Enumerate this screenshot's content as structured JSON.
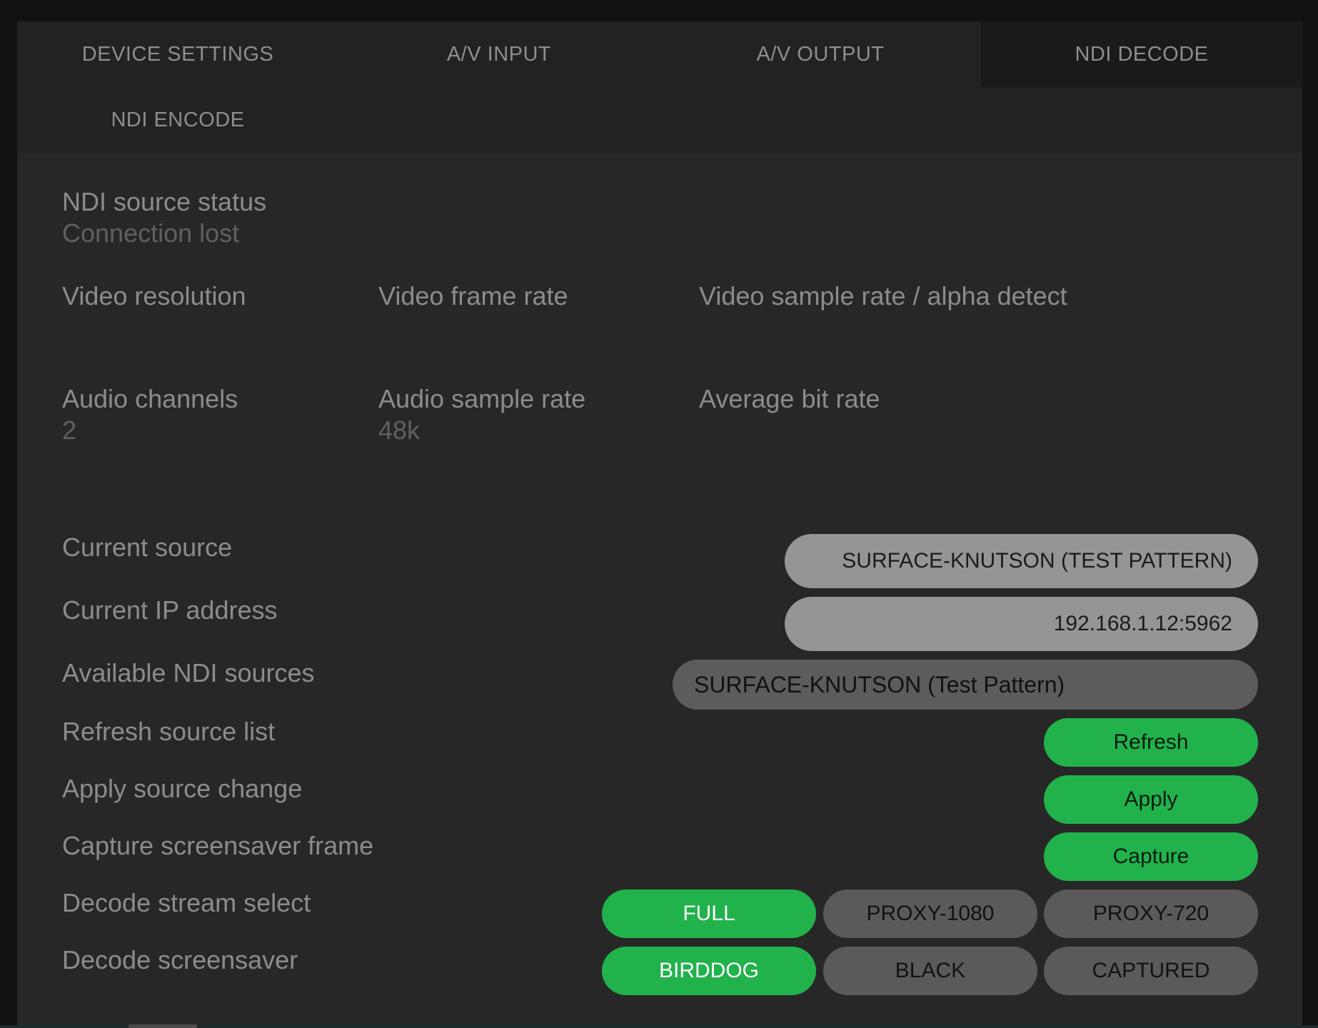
{
  "tabs": [
    {
      "label": "DEVICE SETTINGS",
      "active": false
    },
    {
      "label": "A/V INPUT",
      "active": false
    },
    {
      "label": "A/V OUTPUT",
      "active": false
    },
    {
      "label": "NDI DECODE",
      "active": true
    },
    {
      "label": "NDI ENCODE",
      "active": false
    }
  ],
  "status": {
    "source_status_label": "NDI source status",
    "source_status_value": "Connection lost",
    "video_resolution_label": "Video resolution",
    "video_resolution_value": "",
    "video_frame_rate_label": "Video frame rate",
    "video_frame_rate_value": "",
    "video_sample_rate_label": "Video sample rate / alpha detect",
    "video_sample_rate_value": "",
    "audio_channels_label": "Audio channels",
    "audio_channels_value": "2",
    "audio_sample_rate_label": "Audio sample rate",
    "audio_sample_rate_value": "48k",
    "average_bit_rate_label": "Average bit rate",
    "average_bit_rate_value": ""
  },
  "settings": {
    "current_source_label": "Current source",
    "current_source_value": "SURFACE-KNUTSON (TEST PATTERN)",
    "current_ip_label": "Current IP address",
    "current_ip_value": "192.168.1.12:5962",
    "available_sources_label": "Available NDI sources",
    "available_sources_selected": "SURFACE-KNUTSON (Test Pattern)",
    "refresh_label": "Refresh source list",
    "refresh_button": "Refresh",
    "apply_label": "Apply source change",
    "apply_button": "Apply",
    "capture_label": "Capture screensaver frame",
    "capture_button": "Capture",
    "decode_stream_label": "Decode stream select",
    "decode_stream_options": [
      "FULL",
      "PROXY-1080",
      "PROXY-720"
    ],
    "decode_stream_selected": "FULL",
    "decode_screensaver_label": "Decode screensaver",
    "decode_screensaver_options": [
      "BIRDDOG",
      "BLACK",
      "CAPTURED"
    ],
    "decode_screensaver_selected": "BIRDDOG"
  },
  "colors": {
    "accent_green": "#21b24c",
    "panel_bg": "#272727",
    "tab_bar_bg": "#222222",
    "active_tab_bg": "#1a1a1a"
  }
}
